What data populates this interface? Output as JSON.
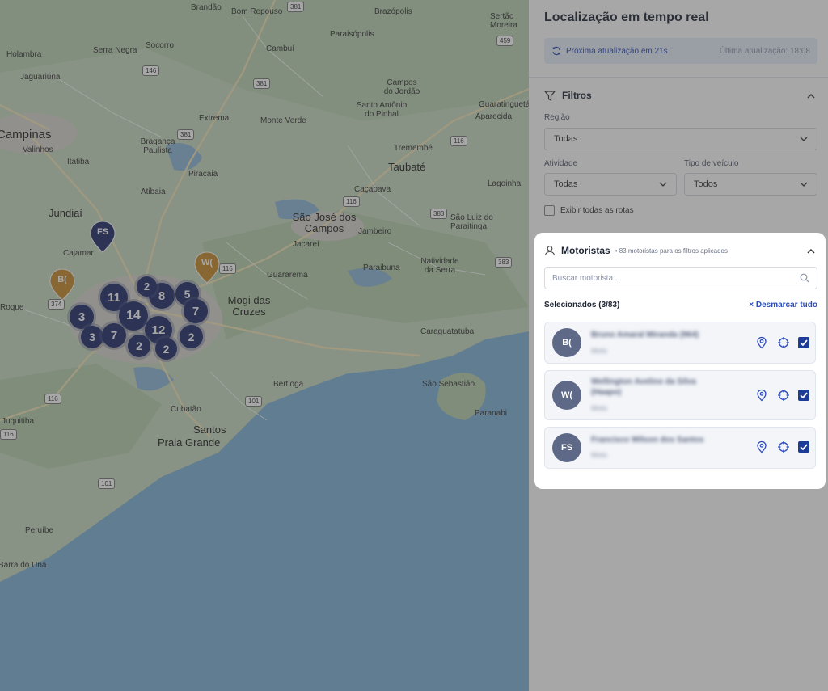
{
  "map": {
    "places": [
      {
        "name": "Brandão",
        "cls": ""
      },
      {
        "name": "Bom Repouso",
        "cls": ""
      },
      {
        "name": "Brazópolis",
        "cls": ""
      },
      {
        "name": "Sertão Moreira",
        "cls": ""
      },
      {
        "name": "Holambra",
        "cls": ""
      },
      {
        "name": "Serra Negra",
        "cls": ""
      },
      {
        "name": "Socorro",
        "cls": ""
      },
      {
        "name": "Cambuí",
        "cls": ""
      },
      {
        "name": "Paraisópolis",
        "cls": ""
      },
      {
        "name": "Jaguariúna",
        "cls": ""
      },
      {
        "name": "Campos do Jordão",
        "cls": ""
      },
      {
        "name": "Santo Antônio do Pinhal",
        "cls": ""
      },
      {
        "name": "Guaratinguetá",
        "cls": ""
      },
      {
        "name": "Aparecida",
        "cls": ""
      },
      {
        "name": "Extrema",
        "cls": ""
      },
      {
        "name": "Monte Verde",
        "cls": ""
      },
      {
        "name": "Campinas",
        "cls": "xl"
      },
      {
        "name": "Bragança Paulista",
        "cls": ""
      },
      {
        "name": "Valinhos",
        "cls": ""
      },
      {
        "name": "Tremembé",
        "cls": ""
      },
      {
        "name": "Itatiba",
        "cls": ""
      },
      {
        "name": "Piracaia",
        "cls": ""
      },
      {
        "name": "Taubaté",
        "cls": "big"
      },
      {
        "name": "Lagoinha",
        "cls": ""
      },
      {
        "name": "Atibaia",
        "cls": ""
      },
      {
        "name": "Caçapava",
        "cls": ""
      },
      {
        "name": "Jundiaí",
        "cls": "big"
      },
      {
        "name": "São José dos Campos",
        "cls": "big"
      },
      {
        "name": "São Luiz do Paraitinga",
        "cls": ""
      },
      {
        "name": "Jambeiro",
        "cls": ""
      },
      {
        "name": "Cajamar",
        "cls": ""
      },
      {
        "name": "Jacareí",
        "cls": ""
      },
      {
        "name": "Mogi das Cruzes",
        "cls": "big"
      },
      {
        "name": "Paraibuna",
        "cls": ""
      },
      {
        "name": "Natividade da Serra",
        "cls": ""
      },
      {
        "name": "Guararema",
        "cls": ""
      },
      {
        "name": "Roque",
        "cls": ""
      },
      {
        "name": "Caraguatatuba",
        "cls": ""
      },
      {
        "name": "Bertioga",
        "cls": ""
      },
      {
        "name": "São Sebastião",
        "cls": ""
      },
      {
        "name": "Cubatão",
        "cls": ""
      },
      {
        "name": "Paranabi",
        "cls": ""
      },
      {
        "name": "Juquitiba",
        "cls": ""
      },
      {
        "name": "Santos",
        "cls": "big"
      },
      {
        "name": "Praia Grande",
        "cls": "big"
      },
      {
        "name": "Peruíbe",
        "cls": ""
      },
      {
        "name": "Barra do Una",
        "cls": ""
      }
    ],
    "shields": [
      "381",
      "146",
      "381",
      "459",
      "381",
      "116",
      "116",
      "116",
      "383",
      "383",
      "374",
      "116",
      "116",
      "101",
      "101"
    ],
    "clusters": [
      "11",
      "14",
      "8",
      "5",
      "7",
      "3",
      "3",
      "7",
      "12",
      "2",
      "2",
      "2",
      "2"
    ],
    "pins": [
      {
        "label": "FS",
        "color": "#1f2d6b"
      },
      {
        "label": "B(",
        "color": "#c98a2c"
      },
      {
        "label": "W(",
        "color": "#c98a2c"
      }
    ]
  },
  "panel": {
    "title": "Localização em tempo real",
    "next_update": "Próxima atualização em 21s",
    "last_update": "Última atualização: 18:08",
    "filters": {
      "title": "Filtros",
      "region_label": "Região",
      "region_value": "Todas",
      "activity_label": "Atividade",
      "activity_value": "Todas",
      "vehicle_label": "Tipo de veículo",
      "vehicle_value": "Todos",
      "show_routes_label": "Exibir todas as rotas"
    },
    "drivers": {
      "title": "Motoristas",
      "count_text": "• 83 motoristas para os filtros aplicados",
      "search_placeholder": "Buscar motorista...",
      "selected_text": "Selecionados (3/83)",
      "clear_text": "× Desmarcar tudo",
      "items": [
        {
          "initials": "B(",
          "name": "Bruno Amaral Miranda (964)",
          "role": "Moto",
          "checked": true
        },
        {
          "initials": "W(",
          "name": "Wellington Avelino da Silva (Haapo)",
          "role": "Moto",
          "checked": true
        },
        {
          "initials": "FS",
          "name": "Francisco Wilson dos Santos",
          "role": "Moto",
          "checked": true
        }
      ]
    }
  },
  "colors": {
    "accent": "#2a4bb8",
    "cluster": "#1f2d6b",
    "pin_orange": "#c98a2c"
  }
}
